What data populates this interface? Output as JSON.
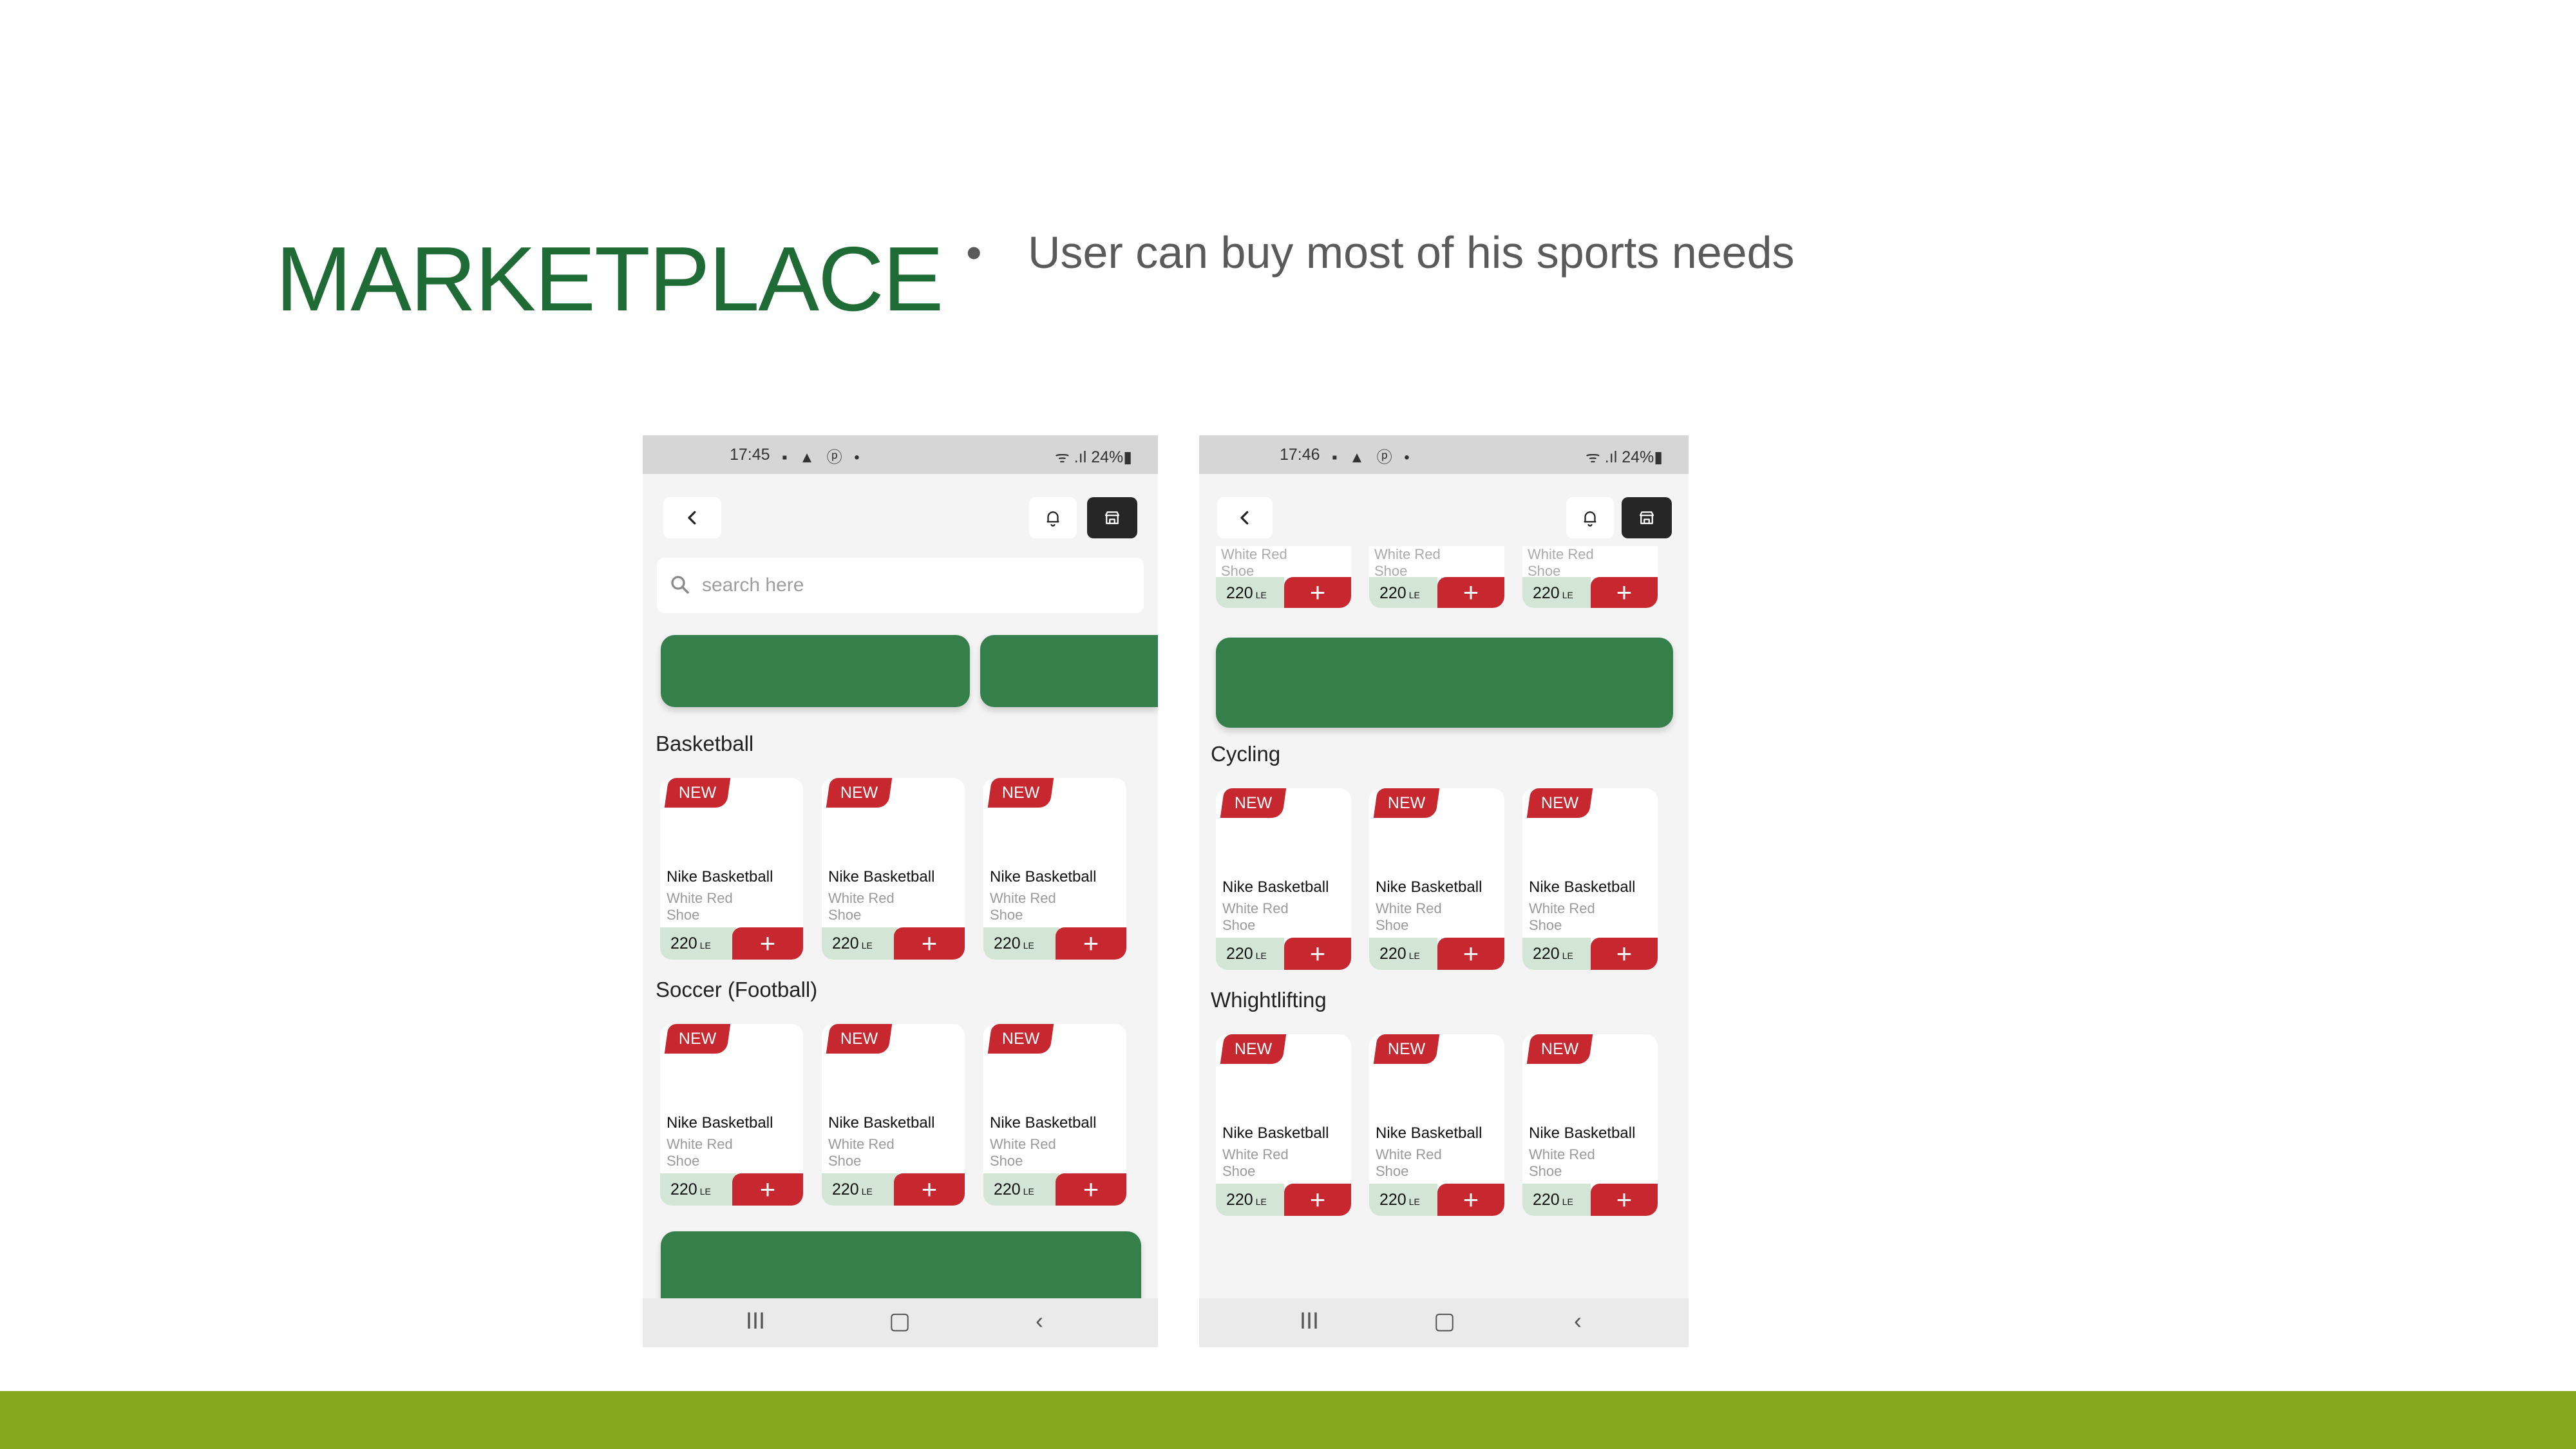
{
  "slide": {
    "title": "MARKETPLACE",
    "bullet_symbol": "•",
    "bullet": "User can buy most of his sports needs",
    "accent_color": "#84a91c",
    "title_color": "#1e6b35"
  },
  "phone1": {
    "status": {
      "time": "17:45",
      "icons": "▪ ▲ ⓟ •",
      "right": "ᯤ .ıl 24%▮"
    },
    "back_icon": "chevron-left-icon",
    "search_placeholder": "search here",
    "sections": [
      {
        "title": "Basketball",
        "cards": [
          {
            "badge": "NEW",
            "name": "Nike Basketball",
            "desc": "White Red Shoe",
            "price": "220",
            "currency": "LE",
            "add": "+"
          },
          {
            "badge": "NEW",
            "name": "Nike Basketball",
            "desc": "White Red Shoe",
            "price": "220",
            "currency": "LE",
            "add": "+"
          },
          {
            "badge": "NEW",
            "name": "Nike Basketball",
            "desc": "White Red Shoe",
            "price": "220",
            "currency": "LE",
            "add": "+"
          }
        ]
      },
      {
        "title": "Soccer (Football)",
        "cards": [
          {
            "badge": "NEW",
            "name": "Nike Basketball",
            "desc": "White Red Shoe",
            "price": "220",
            "currency": "LE",
            "add": "+"
          },
          {
            "badge": "NEW",
            "name": "Nike Basketball",
            "desc": "White Red Shoe",
            "price": "220",
            "currency": "LE",
            "add": "+"
          },
          {
            "badge": "NEW",
            "name": "Nike Basketball",
            "desc": "White Red Shoe",
            "price": "220",
            "currency": "LE",
            "add": "+"
          }
        ]
      }
    ],
    "nav": {
      "recents": "III",
      "home": "▢",
      "back": "‹"
    }
  },
  "phone2": {
    "status": {
      "time": "17:46",
      "icons": "▪ ▲ ⓟ •",
      "right": "ᯤ .ıl 24%▮"
    },
    "top_cards": [
      {
        "desc": "White Red Shoe",
        "price": "220",
        "currency": "LE",
        "add": "+"
      },
      {
        "desc": "White Red Shoe",
        "price": "220",
        "currency": "LE",
        "add": "+"
      },
      {
        "desc": "White Red Shoe",
        "price": "220",
        "currency": "LE",
        "add": "+"
      }
    ],
    "sections": [
      {
        "title": "Cycling",
        "cards": [
          {
            "badge": "NEW",
            "name": "Nike Basketball",
            "desc": "White Red Shoe",
            "price": "220",
            "currency": "LE",
            "add": "+"
          },
          {
            "badge": "NEW",
            "name": "Nike Basketball",
            "desc": "White Red Shoe",
            "price": "220",
            "currency": "LE",
            "add": "+"
          },
          {
            "badge": "NEW",
            "name": "Nike Basketball",
            "desc": "White Red Shoe",
            "price": "220",
            "currency": "LE",
            "add": "+"
          }
        ]
      },
      {
        "title": "Whightlifting",
        "cards": [
          {
            "badge": "NEW",
            "name": "Nike Basketball",
            "desc": "White Red Shoe",
            "price": "220",
            "currency": "LE",
            "add": "+"
          },
          {
            "badge": "NEW",
            "name": "Nike Basketball",
            "desc": "White Red Shoe",
            "price": "220",
            "currency": "LE",
            "add": "+"
          },
          {
            "badge": "NEW",
            "name": "Nike Basketball",
            "desc": "White Red Shoe",
            "price": "220",
            "currency": "LE",
            "add": "+"
          }
        ]
      }
    ],
    "nav": {
      "recents": "III",
      "home": "▢",
      "back": "‹"
    }
  },
  "colors": {
    "banner": "#35804a",
    "badge": "#c7282f",
    "price_bg": "#d3e6d6"
  }
}
